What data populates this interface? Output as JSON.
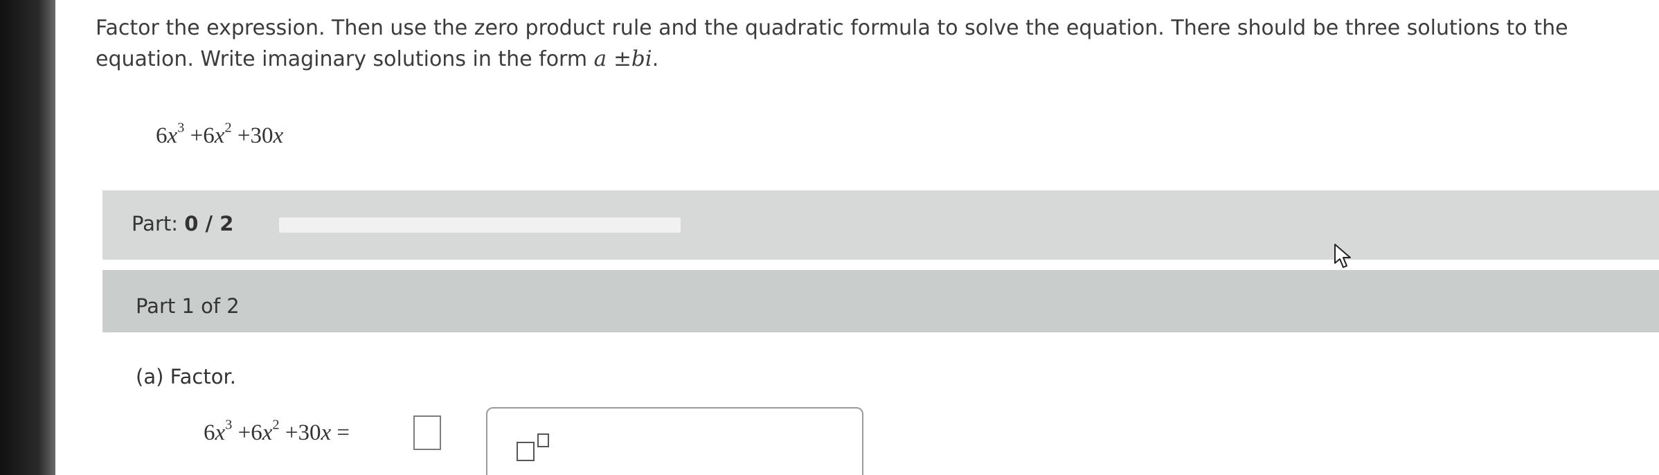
{
  "instructions": {
    "line1": "Factor the expression. Then use the zero product rule and the quadratic formula to solve the equation. There should be three solutions to the",
    "line2_prefix": "equation. Write imaginary solutions in the form ",
    "form": "a ±bi",
    "line2_suffix": "."
  },
  "expression": {
    "t1_coef": "6",
    "t1_var": "x",
    "t1_exp": "3",
    "t2_coef": "+6",
    "t2_var": "x",
    "t2_exp": "2",
    "t3": "+30",
    "t3_var": "x"
  },
  "progress": {
    "label": "Part:",
    "value": "0 / 2",
    "fraction": 0
  },
  "part": {
    "title": "Part 1 of 2",
    "question_label": "(a)  Factor.",
    "answer_suffix": " ="
  },
  "colors": {
    "progress_bg": "#d6d9d8",
    "header_bg": "#c9cdcc",
    "text": "#333333"
  },
  "icons": {
    "palette_button": "exponent-template-icon",
    "cursor": "mouse-pointer-icon"
  }
}
